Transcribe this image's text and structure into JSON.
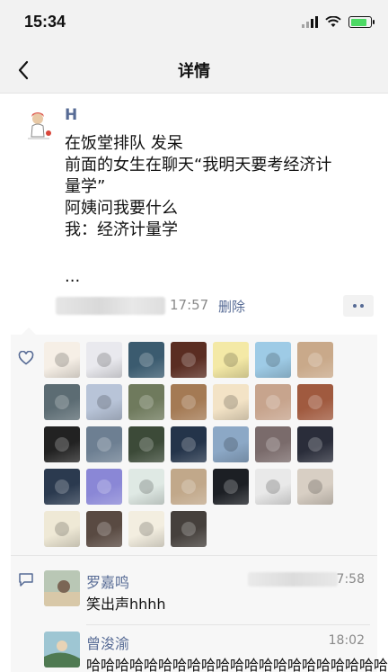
{
  "status": {
    "time": "15:34"
  },
  "nav": {
    "title": "详情",
    "back_icon": "chevron-left-icon"
  },
  "post": {
    "author": "H",
    "lines": [
      "在饭堂排队 发呆",
      "前面的女生在聊天“我明天要考经济计",
      "量学”",
      "阿姨问我要什么",
      "我：经济计量学",
      "",
      "..."
    ],
    "time": "17:57",
    "delete_label": "删除",
    "more_icon": "more-dots-icon"
  },
  "likes": {
    "icon": "heart-icon",
    "avatar_colors": [
      "#f6efe6",
      "#e9e9ee",
      "#3b5b6f",
      "#5a2d22",
      "#f4e9a6",
      "#9ecbe6",
      "#c9a98a",
      "#5c6c73",
      "#b8c4d8",
      "#6f7a5d",
      "#a47a54",
      "#f3e3c6",
      "#c7a48d",
      "#a05a3f",
      "#222222",
      "#6d7f92",
      "#3c4a38",
      "#24344a",
      "#8ca8c6",
      "#7a6b6b",
      "#2a2d3a",
      "#2b3a4f",
      "#8a87d6",
      "#dfe9e4",
      "#c1a88a",
      "#1c1f24",
      "#e9e9e9",
      "#d8cfc4",
      "#efe9d6",
      "#594a42",
      "#f3eee0",
      "#45403c"
    ]
  },
  "comments": {
    "icon": "comment-icon",
    "items": [
      {
        "name": "罗嘉鸣",
        "text": "笑出声hhhh",
        "time": "7:58",
        "avatar_color": "#b9c7b5"
      },
      {
        "name": "曾浚渝",
        "text": "哈哈哈哈哈哈哈哈哈哈哈哈哈哈哈哈哈哈哈哈哈",
        "time": "18:02",
        "avatar_color": "#7fa7b7"
      }
    ]
  },
  "colors": {
    "link": "#576b95",
    "bar": "#f2f2f2",
    "panel": "#f7f7f7",
    "battery": "#4cd964"
  }
}
